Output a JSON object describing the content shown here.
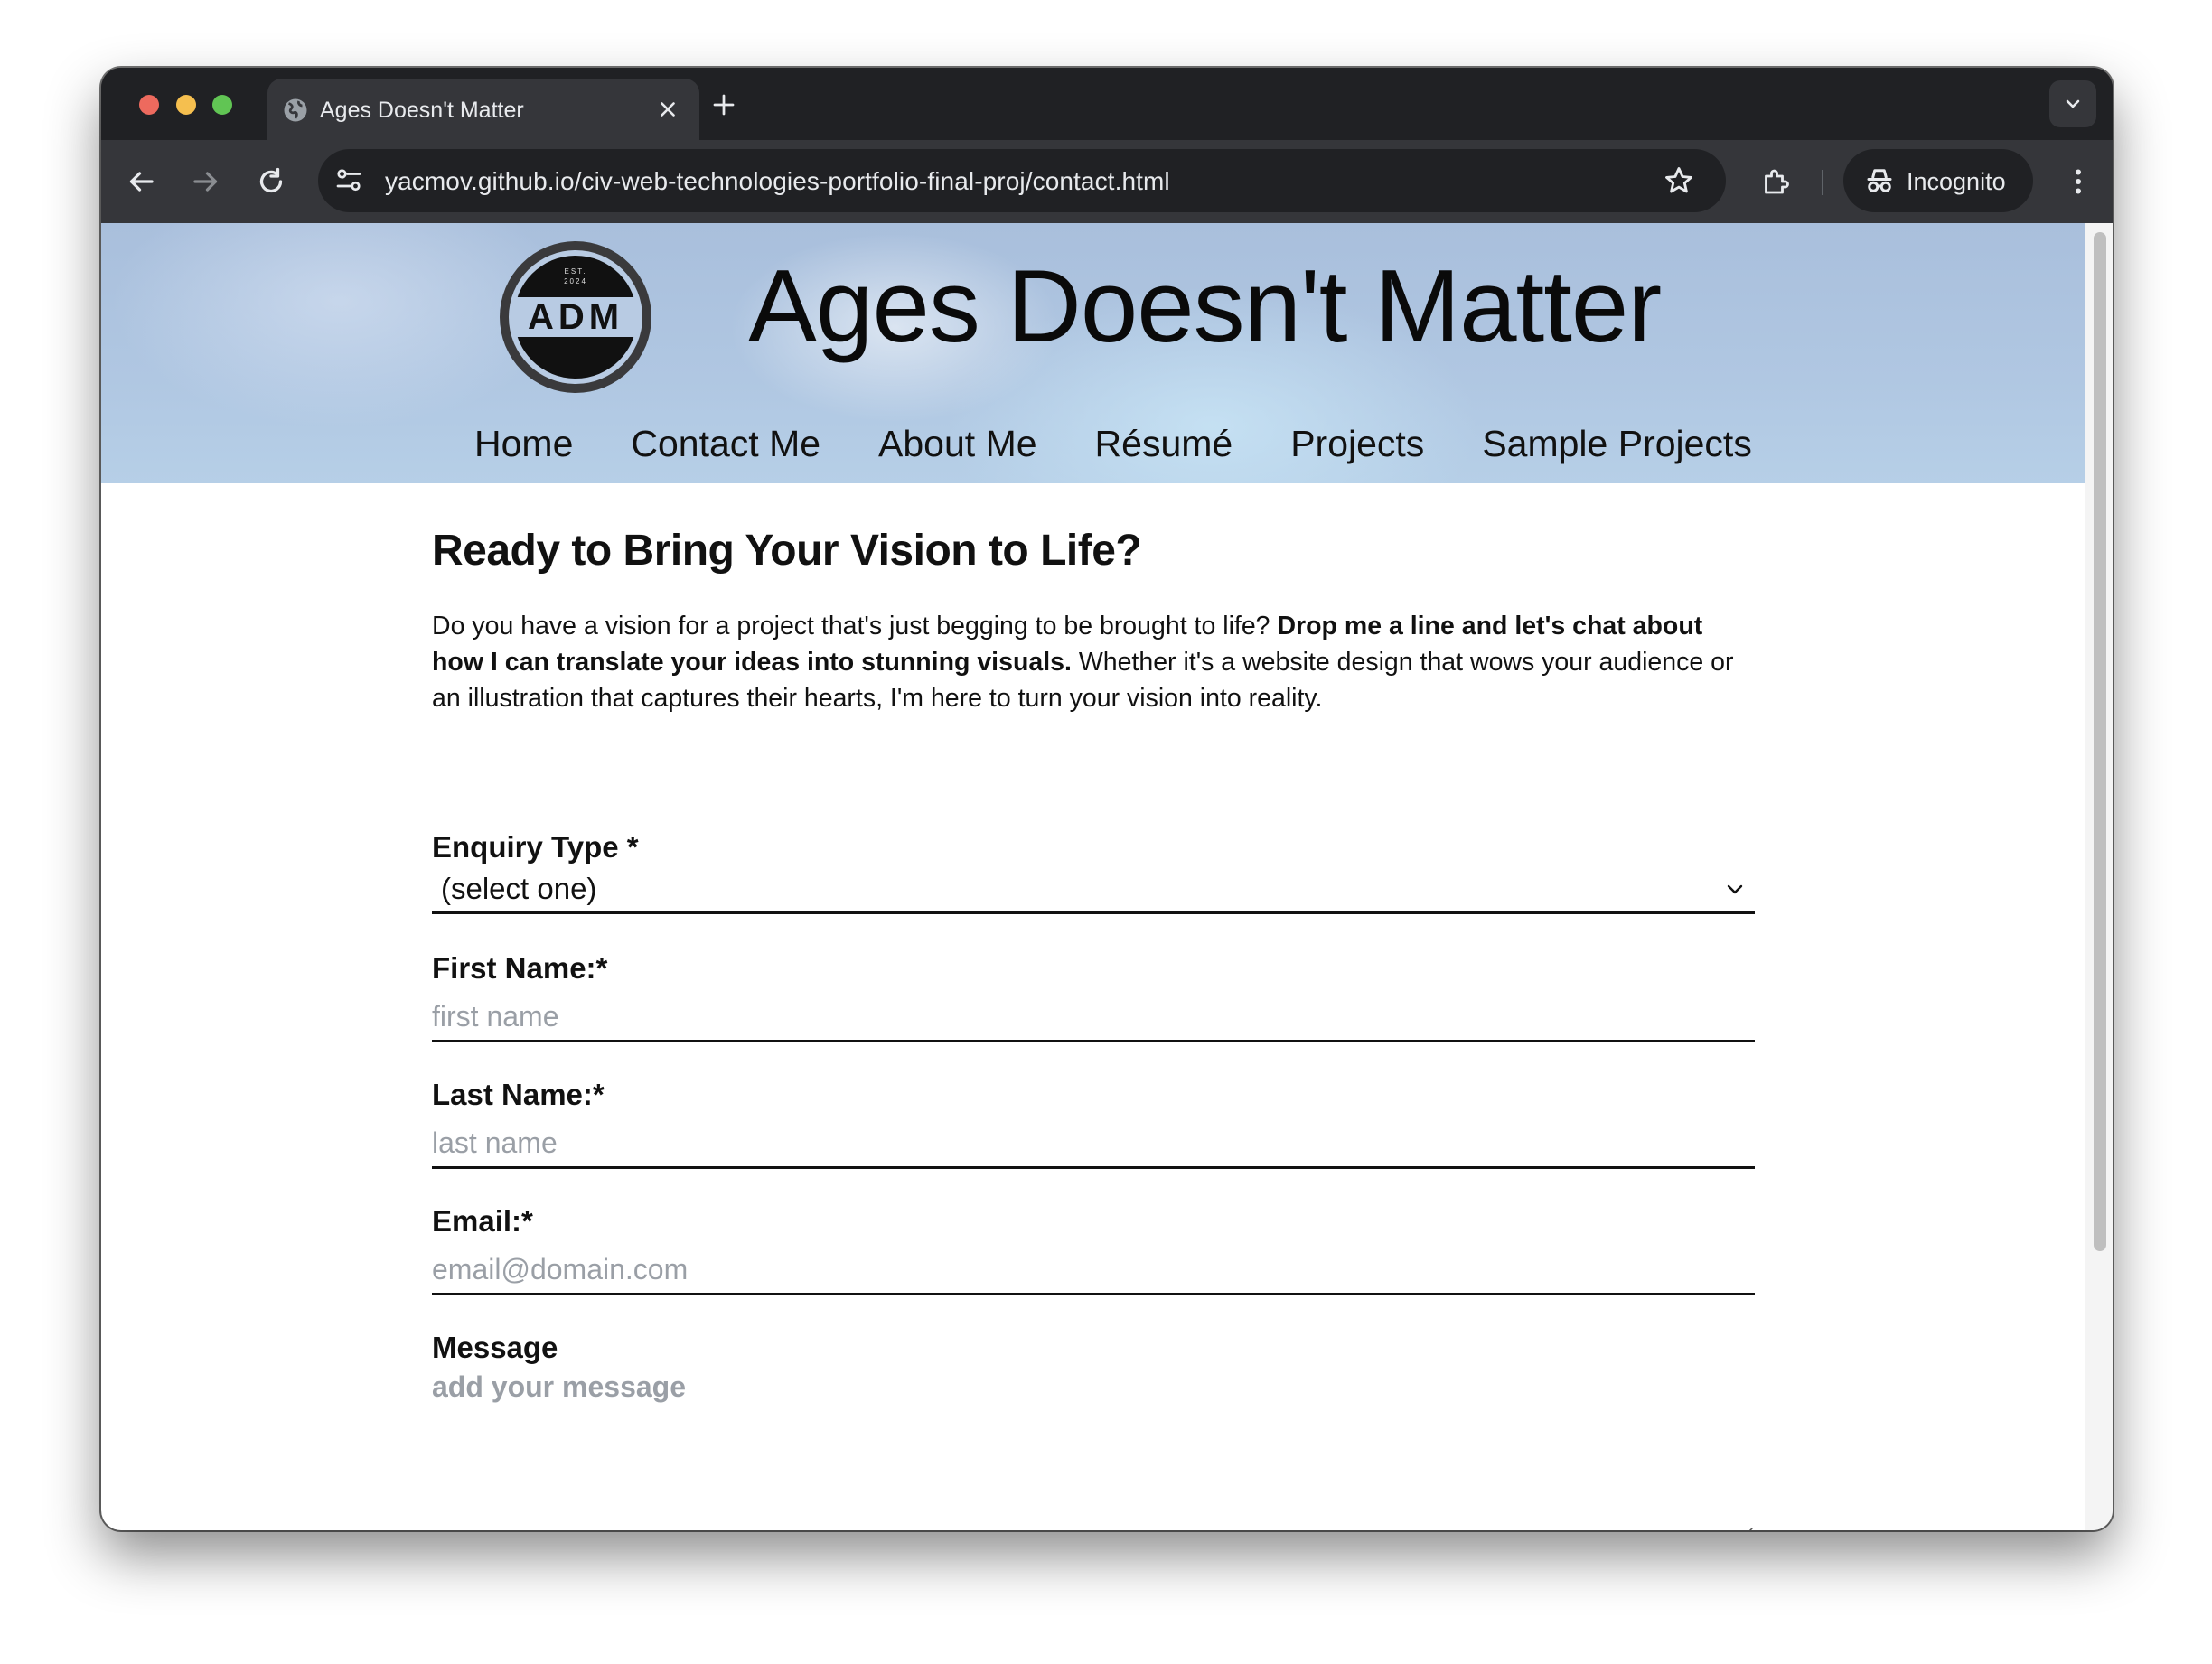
{
  "browser": {
    "tab_title": "Ages Doesn't Matter",
    "url": "yacmov.github.io/civ-web-technologies-portfolio-final-proj/contact.html",
    "profile_label": "Incognito"
  },
  "header": {
    "site_title": "Ages Doesn't Matter",
    "logo": {
      "est_line1": "EST.",
      "est_line2": "2024",
      "letters": "ADM"
    },
    "nav": [
      {
        "label": "Home"
      },
      {
        "label": "Contact Me"
      },
      {
        "label": "About Me"
      },
      {
        "label": "Résumé"
      },
      {
        "label": "Projects"
      },
      {
        "label": "Sample Projects"
      }
    ]
  },
  "main": {
    "heading": "Ready to Bring Your Vision to Life?",
    "intro_part1": "Do you have a vision for a project that's just begging to be brought to life? ",
    "intro_bold": "Drop me a line and let's chat about how I can translate your ideas into stunning visuals.",
    "intro_part2": " Whether it's a website design that wows your audience or an illustration that captures their hearts, I'm here to turn your vision into reality."
  },
  "form": {
    "enquiry": {
      "label": "Enquiry Type *",
      "value": "(select one)"
    },
    "first_name": {
      "label": "First Name:*",
      "placeholder": "first name"
    },
    "last_name": {
      "label": "Last Name:*",
      "placeholder": "last name"
    },
    "email": {
      "label": "Email:*",
      "placeholder": "email@domain.com"
    },
    "message": {
      "label": "Message",
      "placeholder": "add your message"
    }
  },
  "colors": {
    "hero_blue": "#b0c7e2",
    "chrome_dark": "#202124",
    "chrome_toolbar": "#35363a",
    "submit_button": "#c3d3e8"
  },
  "icons": [
    "globe-icon",
    "close-icon",
    "plus-icon",
    "chevron-down-icon",
    "back-arrow-icon",
    "forward-arrow-icon",
    "reload-icon",
    "site-info-icon",
    "star-icon",
    "extensions-icon",
    "incognito-icon",
    "more-vert-icon"
  ]
}
